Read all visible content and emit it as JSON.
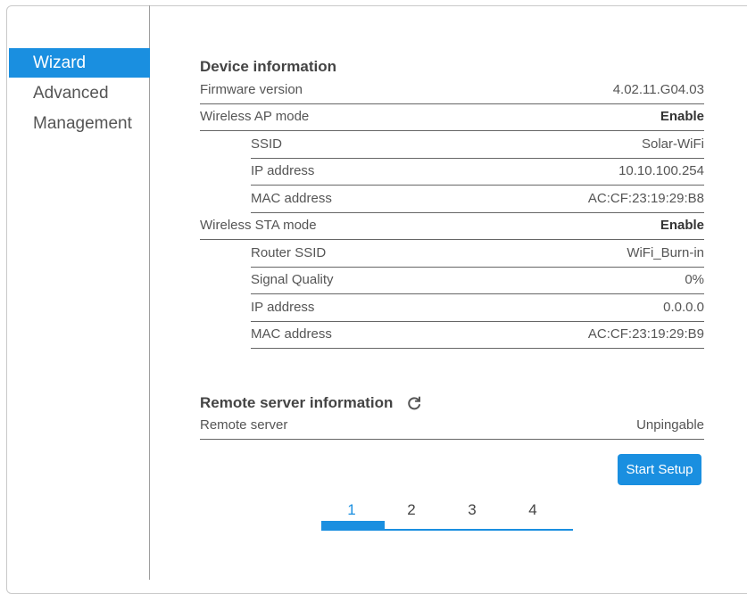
{
  "sidebar": {
    "items": [
      {
        "label": "Wizard",
        "active": true
      },
      {
        "label": "Advanced",
        "active": false
      },
      {
        "label": "Management",
        "active": false
      }
    ]
  },
  "device_info": {
    "title": "Device information",
    "firmware": {
      "label": "Firmware version",
      "value": "4.02.11.G04.03"
    },
    "ap_mode": {
      "label": "Wireless AP mode",
      "value": "Enable"
    },
    "ap": {
      "ssid": {
        "label": "SSID",
        "value": "Solar-WiFi"
      },
      "ip": {
        "label": "IP address",
        "value": "10.10.100.254"
      },
      "mac": {
        "label": "MAC address",
        "value": "AC:CF:23:19:29:B8"
      }
    },
    "sta_mode": {
      "label": "Wireless STA mode",
      "value": "Enable"
    },
    "sta": {
      "router_ssid": {
        "label": "Router SSID",
        "value": "WiFi_Burn-in"
      },
      "signal": {
        "label": "Signal Quality",
        "value": "0%"
      },
      "ip": {
        "label": "IP address",
        "value": "0.0.0.0"
      },
      "mac": {
        "label": "MAC address",
        "value": "AC:CF:23:19:29:B9"
      }
    }
  },
  "remote_server": {
    "title": "Remote server information",
    "server": {
      "label": "Remote server",
      "value": "Unpingable"
    }
  },
  "actions": {
    "start_setup": "Start Setup"
  },
  "stepper": {
    "steps": [
      "1",
      "2",
      "3",
      "4"
    ],
    "current_step": 1,
    "progress_fraction": 0.25
  },
  "colors": {
    "accent": "#1a8fe0"
  }
}
